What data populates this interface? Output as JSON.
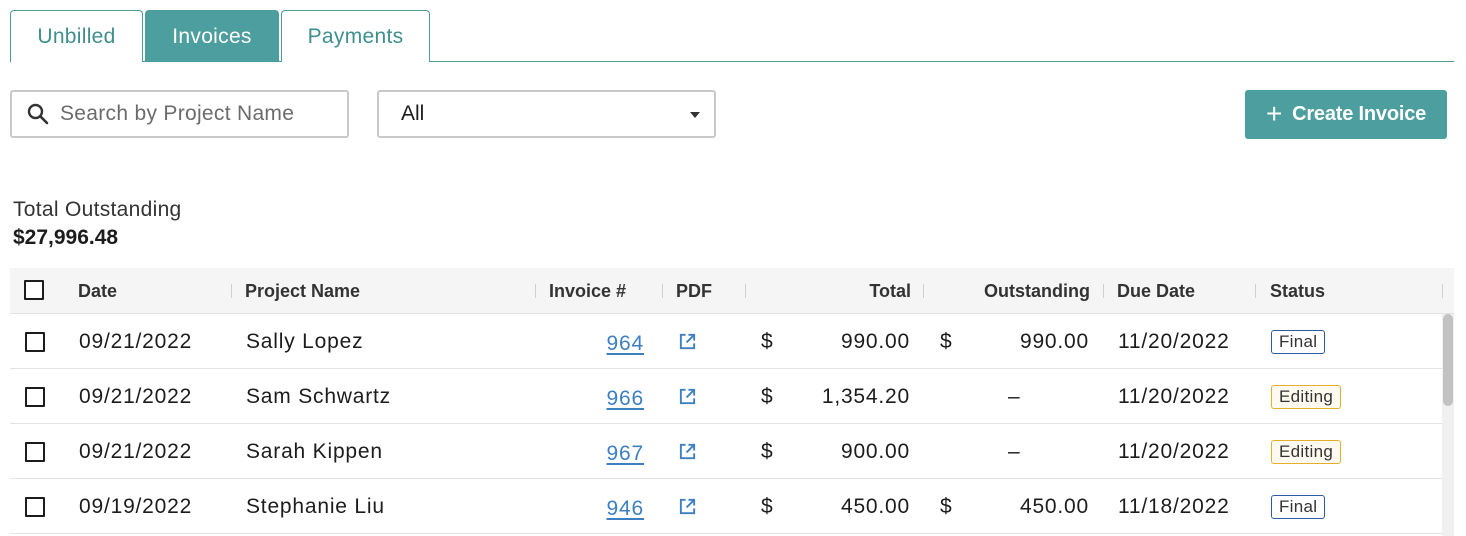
{
  "tabs": [
    {
      "label": "Unbilled",
      "active": false
    },
    {
      "label": "Invoices",
      "active": true
    },
    {
      "label": "Payments",
      "active": false
    }
  ],
  "search": {
    "placeholder": "Search by Project Name",
    "value": "",
    "icon": "search-icon"
  },
  "filter": {
    "selected": "All"
  },
  "create_button": {
    "label": "Create Invoice",
    "icon": "plus-icon"
  },
  "summary": {
    "label": "Total Outstanding",
    "value": "$27,996.48"
  },
  "table": {
    "columns": {
      "date": "Date",
      "project": "Project Name",
      "invoice": "Invoice #",
      "pdf": "PDF",
      "total": "Total",
      "outstanding": "Outstanding",
      "due": "Due Date",
      "status": "Status"
    },
    "rows": [
      {
        "date": "09/21/2022",
        "project": "Sally Lopez",
        "invoice": "964",
        "total_currency": "$",
        "total": "990.00",
        "outstanding_currency": "$",
        "outstanding": "990.00",
        "due": "11/20/2022",
        "status": "Final"
      },
      {
        "date": "09/21/2022",
        "project": "Sam Schwartz",
        "invoice": "966",
        "total_currency": "$",
        "total": "1,354.20",
        "outstanding_currency": "",
        "outstanding": "–",
        "due": "11/20/2022",
        "status": "Editing"
      },
      {
        "date": "09/21/2022",
        "project": "Sarah Kippen",
        "invoice": "967",
        "total_currency": "$",
        "total": "900.00",
        "outstanding_currency": "",
        "outstanding": "–",
        "due": "11/20/2022",
        "status": "Editing"
      },
      {
        "date": "09/19/2022",
        "project": "Stephanie Liu",
        "invoice": "946",
        "total_currency": "$",
        "total": "450.00",
        "outstanding_currency": "$",
        "outstanding": "450.00",
        "due": "11/18/2022",
        "status": "Final"
      }
    ]
  },
  "colors": {
    "accent": "#4d9e9e",
    "link": "#3d7fc1",
    "final_border": "#2f5aa3",
    "editing_border": "#e2b02a"
  }
}
